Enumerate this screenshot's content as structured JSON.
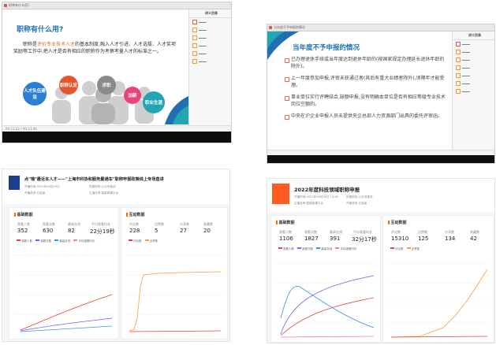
{
  "tl": {
    "window_title": "职称有什么用?",
    "slide_title": "职称有什么用?",
    "paragraph_pre": "职称是",
    "paragraph_highlight": "评价专业技术人才",
    "paragraph_post": "的基本制度,融入人才引进、人才选拔、人才奖项奖励等工作中,把人才是否有相应的职称作为考察考量人才的标准之一。",
    "circles": [
      "人才队伍建设",
      "职称认定",
      "求职",
      "加薪",
      "职业生涯"
    ],
    "sidebar_tab": "讲义目录",
    "bottom_time": "00:11:22 / 00:13:40"
  },
  "tr": {
    "window_title": "当年度不予申报的情况",
    "slide_title": "当年度不予申报的情况",
    "bullets": [
      "已办理退休手续或当年度达到退休年龄的(按国家规定办理延长退休年龄的除外)。",
      "上一年度参加申报,评审未获通过者(其后有重大业绩者除外),须隔年才能受理。",
      "事业单位实行评聘结合,缺额申报,没有明确本单位是否有相应等级专业技术岗位空额的。",
      "中央在沪企业申报人员未提供央企总部人力资源部门出具的委托评审函。"
    ],
    "sidebar_tab": "讲义目录"
  },
  "bl": {
    "title": "点\"墙\"最近本人才——\"上海市科协和服务最通车\"职称申报政策线上专场直讲",
    "meta": [
      "开播时间:2022年09月29日",
      "所属机构:公众号推送",
      "开播状态:已结束",
      "主播名称:智能网课平台"
    ],
    "basic_title": "基础数据",
    "basic_labels": [
      "观看人数",
      "观看次数",
      "最高在线",
      "平均观看时长"
    ],
    "basic_values": [
      "352",
      "630",
      "82",
      "22分19秒"
    ],
    "inter_title": "互动数据",
    "inter_labels": [
      "评论数",
      "点赞数",
      "分享数",
      "收藏数"
    ],
    "inter_values": [
      "228",
      "5",
      "27",
      "20"
    ],
    "legend_basic": [
      "观看人数",
      "观看次数",
      "最高在线",
      "平均观看时长"
    ],
    "legend_inter": [
      "评论数",
      "点赞数"
    ]
  },
  "br": {
    "title": "2022年度科技领域职称申报",
    "meta": [
      "开播时间:2022年09月28日 14:00",
      "所属机构:公众号推送",
      "主播名称:智能网课平台",
      "开播状态:已结束"
    ],
    "basic_title": "基础数据",
    "basic_labels": [
      "观看人数",
      "观看次数",
      "最高在线",
      "平均观看时长"
    ],
    "basic_values": [
      "1106",
      "1827",
      "391",
      "32分17秒"
    ],
    "inter_title": "互动数据",
    "inter_labels": [
      "评论数",
      "点赞数",
      "分享数",
      "收藏数"
    ],
    "inter_values": [
      "15310",
      "125",
      "134",
      "42"
    ],
    "legend_basic": [
      "观看人数",
      "观看次数",
      "最高在线",
      "平均观看时长"
    ],
    "legend_inter": [
      "评论数",
      "点赞数"
    ]
  },
  "colors": {
    "accent": "#ff6a00",
    "blue_title": "#1f6fb2",
    "orange_text": "#e36a20",
    "line_red": "#e0413c",
    "line_purple": "#7a5cf0",
    "line_blue": "#3b8ef0",
    "line_pink": "#f27ab0"
  }
}
